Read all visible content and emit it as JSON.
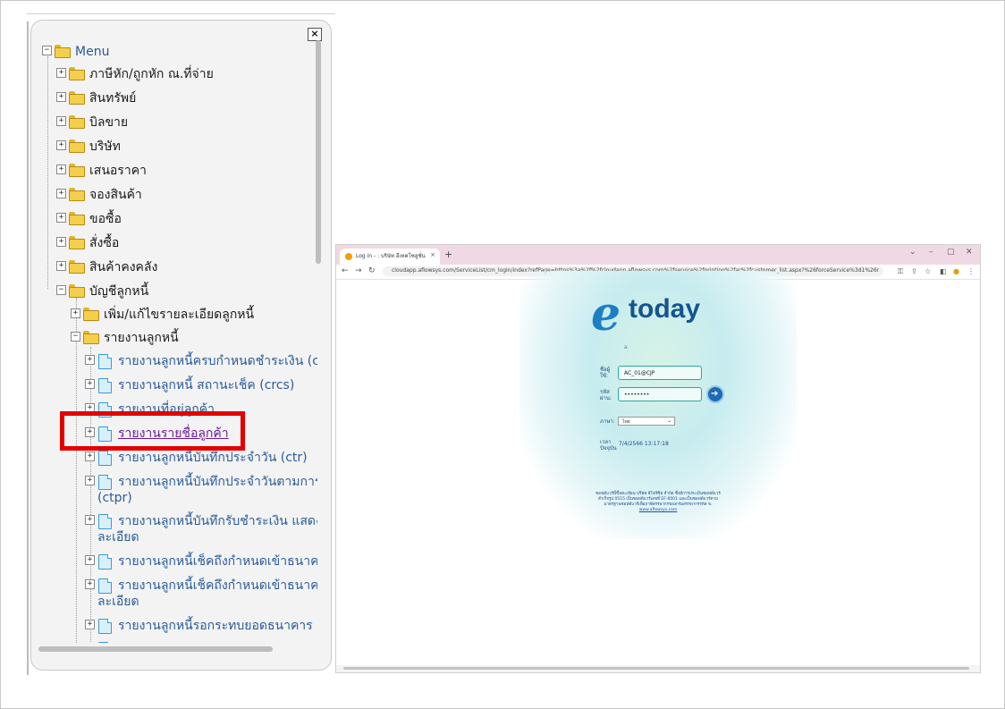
{
  "menu_panel": {
    "close_label": "×",
    "root_label": "Menu",
    "items": [
      {
        "label": "ภาษีหัก/ถูกหัก ณ.ที่จ่าย"
      },
      {
        "label": "สินทรัพย์"
      },
      {
        "label": "บิลขาย"
      },
      {
        "label": "บริษัท"
      },
      {
        "label": "เสนอราคา"
      },
      {
        "label": "จองสินค้า"
      },
      {
        "label": "ขอซื้อ"
      },
      {
        "label": "สั่งซื้อ"
      },
      {
        "label": "สินค้าคงคลัง"
      },
      {
        "label": "บัญชีลูกหนี้"
      }
    ],
    "sub_items": [
      {
        "label": "เพิ่ม/แก้ไขรายละเอียดลูกหนี้"
      },
      {
        "label": "รายงานลูกหนี้"
      }
    ],
    "report_items": [
      {
        "label": "รายงานลูกหนี้ครบกำหนดชำระเงิน (cda"
      },
      {
        "label": "รายงานลูกหนี้ สถานะเช็ค (crcs)"
      },
      {
        "label": "รายงานที่อยู่ลูกค้า"
      },
      {
        "label": "รายงานรายชื่อลูกค้า"
      },
      {
        "label": "รายงานลูกหนี้บันทึกประจำวัน (ctr)"
      },
      {
        "label": "รายงานลูกหนี้บันทึกประจำวันตามการช",
        "cont": "(ctpr)"
      },
      {
        "label": "รายงานลูกหนี้บันทึกรับชำระเงิน แสดงร",
        "cont": "ละเอียด"
      },
      {
        "label": "รายงานลูกหนี้เช็คถึงกำหนดเข้าธนาคาร"
      },
      {
        "label": "รายงานลูกหนี้เช็คถึงกำหนดเข้าธนาคาร",
        "cont": "ละเอียด"
      },
      {
        "label": "รายงานลูกหนี้รอกระทบยอดธนาคาร"
      }
    ]
  },
  "browser": {
    "tab_title": "Log in - : บริษัท อีเทคโซลูชั่น จำกัด",
    "tab_close": "×",
    "new_tab": "+",
    "win_min": "–",
    "win_max": "▢",
    "win_close": "✕",
    "win_chevron": "⌄",
    "url": "cloudapp.aflowsys.com/ServiceList/cm_login/index?refPage=https%3a%2f%2fcloudapp.aflowsys.com%2fservice%2fprinting%2far%2fcustomer_list.aspx?%26forceService%3d1%26redirect%3d1&...",
    "logo_e": "e",
    "logo_text": "today",
    "logo_mark": "a",
    "username_label": "ชื่อผู้ใช้:",
    "username_value": "AC_01@CJP",
    "password_label": "รหัสผ่าน:",
    "password_value": "••••••••",
    "language_label": "ภาษา:",
    "language_value": "ไทย",
    "datetime_label": "เวลาปัจจุบัน",
    "datetime_value": "7/4/2566 13:17:18",
    "footer_text": "ซอฟต์แวร์นี้ขึ้นทะเบียน บริษัท อีโฟร์ซิส จำกัด ซึ่งมีการประเมินซอฟต์แวร์สำเร็จรูป 0515 เป็นซอฟต์แวร์เลขที่ EF-0001 และเป็นซอฟต์แวร์ตามมาตรฐานซอฟต์แวร์เพื่อภาษีสรรพากรของกรมสรรพากรรหัส ข.",
    "footer_link": "www.aflowsys.com"
  },
  "colors": {
    "highlight": "#e30000",
    "menu_text": "#2a5b9a",
    "browser_tabbar": "#f0d9e4",
    "logo_blue": "#1d7fc3"
  }
}
